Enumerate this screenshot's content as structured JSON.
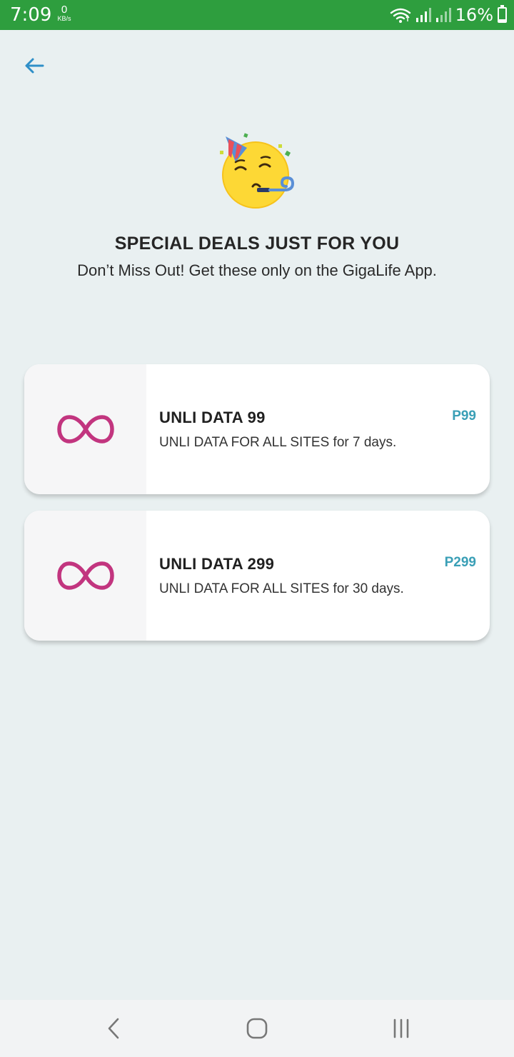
{
  "status_bar": {
    "time": "7:09",
    "network_speed": "0",
    "network_speed_unit": "KB/s",
    "battery_percent": "16%",
    "battery_level": 0.16,
    "background_color": "#2e9e3e"
  },
  "header": {
    "back_icon": "arrow-left-icon",
    "accent_color": "#2f8fc8"
  },
  "hero": {
    "emoji_icon": "party-face-icon",
    "title": "SPECIAL DEALS JUST FOR YOU",
    "subtitle": "Don’t Miss Out! Get these only on the GigaLife App."
  },
  "deals": [
    {
      "icon": "infinity-icon",
      "title": "UNLI DATA 99",
      "description": "UNLI DATA FOR ALL SITES for 7 days.",
      "price": "P99"
    },
    {
      "icon": "infinity-icon",
      "title": "UNLI DATA 299",
      "description": "UNLI DATA FOR ALL SITES for 30 days.",
      "price": "P299"
    }
  ],
  "colors": {
    "background": "#e9f0f1",
    "price": "#3a9fb6",
    "infinity": "#c2357f"
  },
  "nav_bar": {
    "back_icon": "chevron-left-icon",
    "home_icon": "home-icon",
    "recents_icon": "recents-icon"
  }
}
